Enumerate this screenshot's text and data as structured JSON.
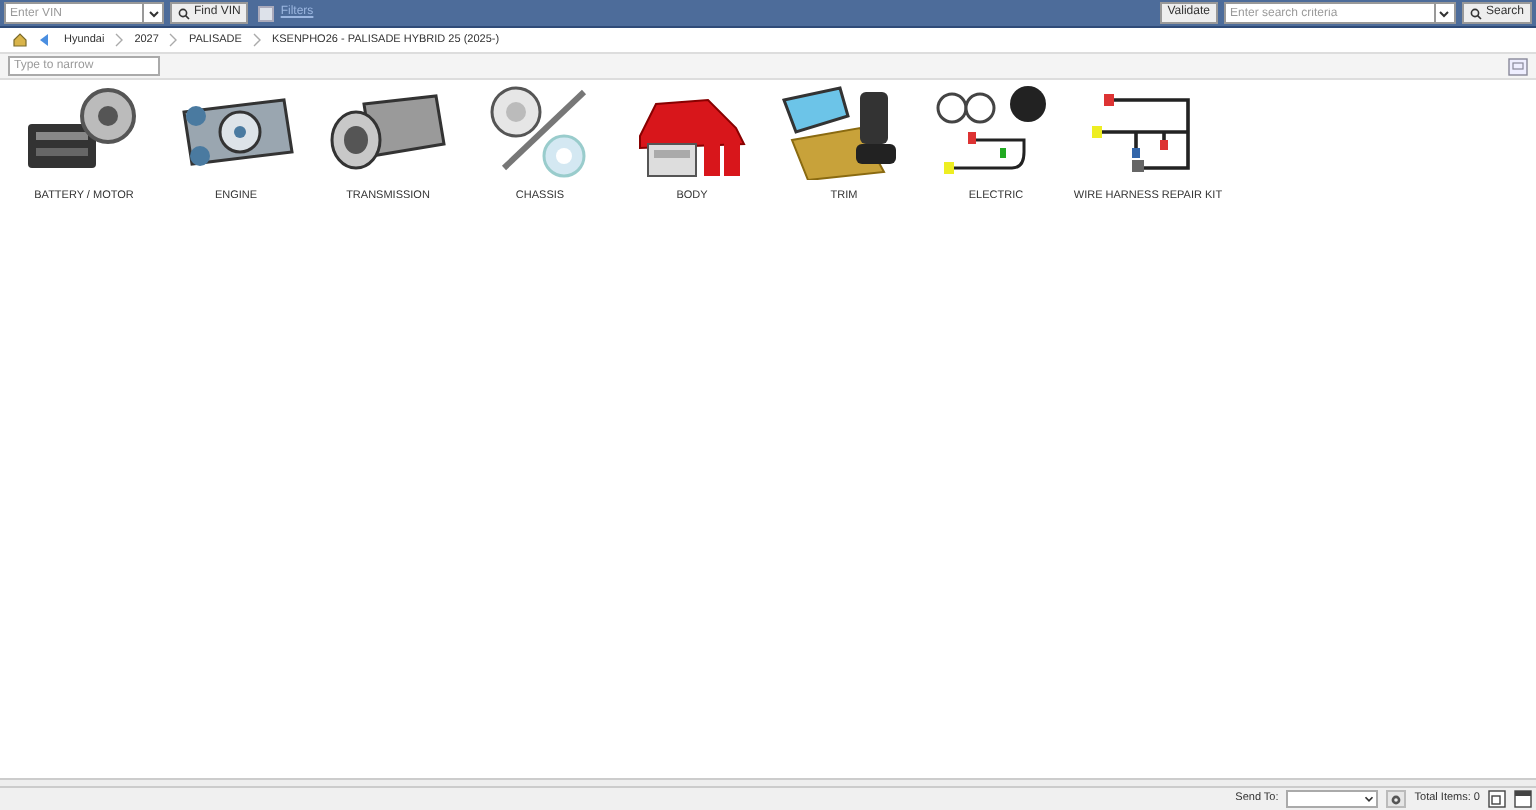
{
  "toolbar": {
    "vin_field": {
      "placeholder": "Enter VIN"
    },
    "find_vin_button": "Find VIN",
    "filters": {
      "label": "Filters",
      "checked": false
    },
    "validate_button": "Validate",
    "search_field": {
      "placeholder": "Enter search criteria"
    },
    "search_button": "Search"
  },
  "breadcrumb": [
    "Hyundai",
    "2027",
    "PALISADE",
    "KSENPHO26 - PALISADE HYBRID 25 (2025-)"
  ],
  "narrow_field": {
    "placeholder": "Type to narrow"
  },
  "categories": [
    {
      "label": "BATTERY / MOTOR",
      "kind": "battery"
    },
    {
      "label": "ENGINE",
      "kind": "engine"
    },
    {
      "label": "TRANSMISSION",
      "kind": "transmission"
    },
    {
      "label": "CHASSIS",
      "kind": "chassis"
    },
    {
      "label": "BODY",
      "kind": "body"
    },
    {
      "label": "TRIM",
      "kind": "trim"
    },
    {
      "label": "ELECTRIC",
      "kind": "electric"
    },
    {
      "label": "WIRE HARNESS REPAIR KIT",
      "kind": "harness"
    }
  ],
  "status_bar": {
    "send_to_label": "Send To:",
    "total_items": "Total Items: 0"
  }
}
